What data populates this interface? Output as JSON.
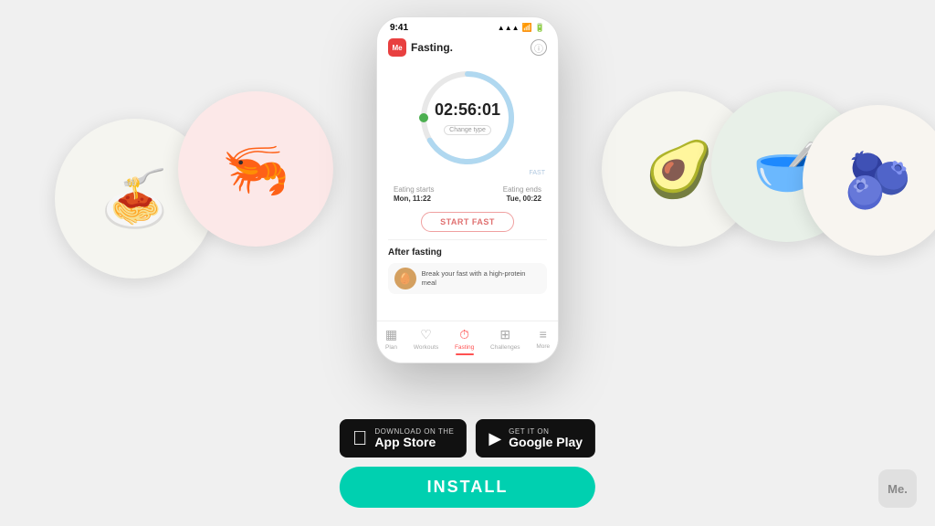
{
  "app": {
    "logo_text": "Me",
    "name": "Fasting.",
    "status_time": "9:41",
    "timer": "02:56:01",
    "change_type": "Change type",
    "fast_label": "FAST",
    "eating_starts_label": "Eating starts",
    "eating_starts_value": "Mon, 11:22",
    "eating_ends_label": "Eating ends",
    "eating_ends_value": "Tue, 00:22",
    "start_fast_btn": "START FAST",
    "after_fasting_title": "After fasting",
    "meal_suggestion": "Break your fast with a high-protein meal",
    "nav": [
      {
        "label": "Plan",
        "icon": "▦",
        "active": false
      },
      {
        "label": "Workouts",
        "icon": "♡",
        "active": false
      },
      {
        "label": "Fasting",
        "icon": "⏱",
        "active": true
      },
      {
        "label": "Challenges",
        "icon": "⊞",
        "active": false
      },
      {
        "label": "More",
        "icon": "≡",
        "active": false
      }
    ]
  },
  "store": {
    "apple_sub": "Download on the",
    "apple_main": "App Store",
    "google_sub": "GET IT ON",
    "google_main": "Google Play",
    "install_label": "INSTALL"
  },
  "me_badge": "Me.",
  "plates": [
    {
      "emoji": "🍝",
      "position": "left-far"
    },
    {
      "emoji": "🦐",
      "position": "left-near"
    },
    {
      "emoji": "🥑",
      "position": "right-near"
    },
    {
      "emoji": "🥣",
      "position": "right-mid"
    },
    {
      "emoji": "🫐",
      "position": "right-far"
    }
  ]
}
